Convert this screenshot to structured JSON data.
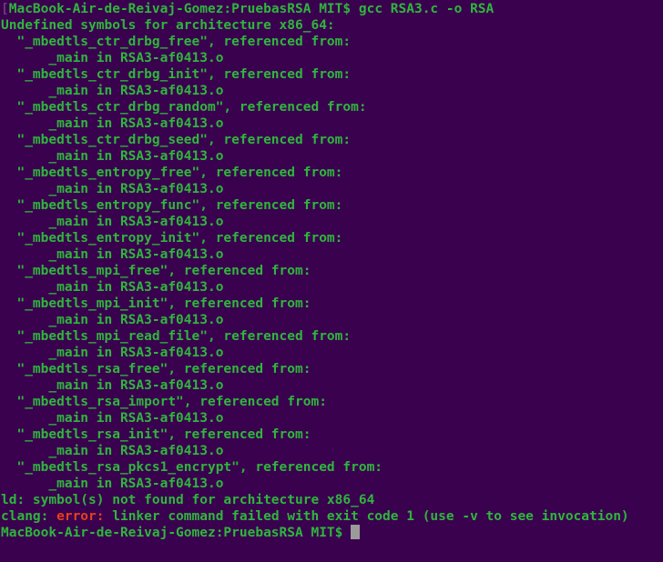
{
  "terminal": {
    "title": "Terminal",
    "background_color": "#3a014f",
    "foreground_color": "#2fb63c",
    "error_color": "#e8401a",
    "cursor_color": "#9b9b9b",
    "columns": 80,
    "rows": 34,
    "prompt": "MacBook-Air-de-Reivaj-Gomez:PruebasRSA MIT$",
    "leading_artifact": "[",
    "cursor_glyph": "block-cursor"
  },
  "lines": [
    {
      "type": "prompt",
      "prefix_artifact": "[",
      "prompt": "MacBook-Air-de-Reivaj-Gomez:PruebasRSA MIT$",
      "command": " gcc RSA3.c -o RSA"
    },
    {
      "type": "text",
      "text": "Undefined symbols for architecture x86_64:"
    },
    {
      "type": "text",
      "text": "  \"_mbedtls_ctr_drbg_free\", referenced from:"
    },
    {
      "type": "text",
      "text": "      _main in RSA3-af0413.o"
    },
    {
      "type": "text",
      "text": "  \"_mbedtls_ctr_drbg_init\", referenced from:"
    },
    {
      "type": "text",
      "text": "      _main in RSA3-af0413.o"
    },
    {
      "type": "text",
      "text": "  \"_mbedtls_ctr_drbg_random\", referenced from:"
    },
    {
      "type": "text",
      "text": "      _main in RSA3-af0413.o"
    },
    {
      "type": "text",
      "text": "  \"_mbedtls_ctr_drbg_seed\", referenced from:"
    },
    {
      "type": "text",
      "text": "      _main in RSA3-af0413.o"
    },
    {
      "type": "text",
      "text": "  \"_mbedtls_entropy_free\", referenced from:"
    },
    {
      "type": "text",
      "text": "      _main in RSA3-af0413.o"
    },
    {
      "type": "text",
      "text": "  \"_mbedtls_entropy_func\", referenced from:"
    },
    {
      "type": "text",
      "text": "      _main in RSA3-af0413.o"
    },
    {
      "type": "text",
      "text": "  \"_mbedtls_entropy_init\", referenced from:"
    },
    {
      "type": "text",
      "text": "      _main in RSA3-af0413.o"
    },
    {
      "type": "text",
      "text": "  \"_mbedtls_mpi_free\", referenced from:"
    },
    {
      "type": "text",
      "text": "      _main in RSA3-af0413.o"
    },
    {
      "type": "text",
      "text": "  \"_mbedtls_mpi_init\", referenced from:"
    },
    {
      "type": "text",
      "text": "      _main in RSA3-af0413.o"
    },
    {
      "type": "text",
      "text": "  \"_mbedtls_mpi_read_file\", referenced from:"
    },
    {
      "type": "text",
      "text": "      _main in RSA3-af0413.o"
    },
    {
      "type": "text",
      "text": "  \"_mbedtls_rsa_free\", referenced from:"
    },
    {
      "type": "text",
      "text": "      _main in RSA3-af0413.o"
    },
    {
      "type": "text",
      "text": "  \"_mbedtls_rsa_import\", referenced from:"
    },
    {
      "type": "text",
      "text": "      _main in RSA3-af0413.o"
    },
    {
      "type": "text",
      "text": "  \"_mbedtls_rsa_init\", referenced from:"
    },
    {
      "type": "text",
      "text": "      _main in RSA3-af0413.o"
    },
    {
      "type": "text",
      "text": "  \"_mbedtls_rsa_pkcs1_encrypt\", referenced from:"
    },
    {
      "type": "text",
      "text": "      _main in RSA3-af0413.o"
    },
    {
      "type": "text",
      "text": "ld: symbol(s) not found for architecture x86_64"
    },
    {
      "type": "error",
      "before": "clang: ",
      "error_label": "error:",
      "after": " linker command failed with exit code 1 (use -v to see invocation)"
    },
    {
      "type": "prompt_cursor",
      "prompt": "MacBook-Air-de-Reivaj-Gomez:PruebasRSA MIT$",
      "command": " "
    }
  ]
}
